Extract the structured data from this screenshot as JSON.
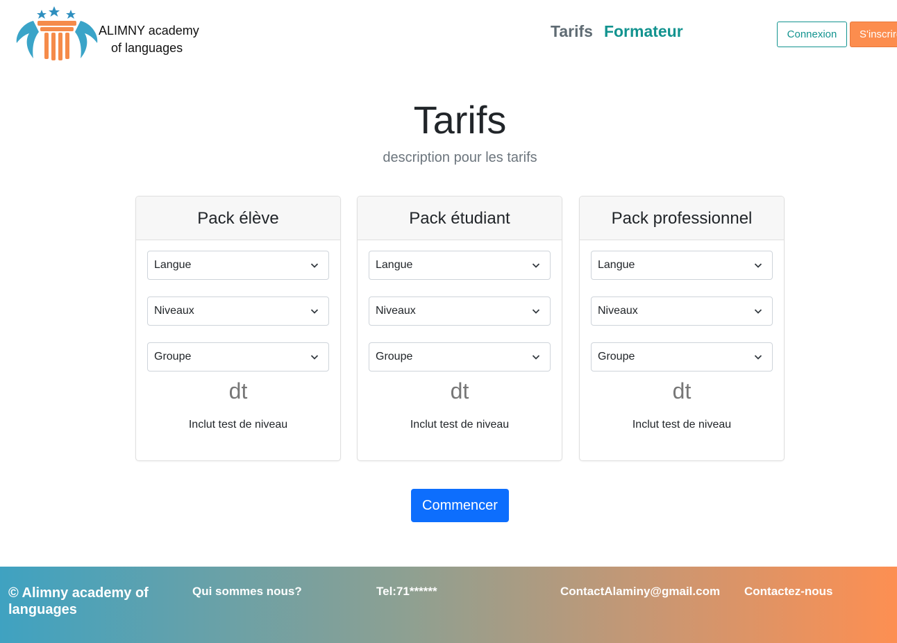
{
  "header": {
    "brand_line1": "ALIMNY academy",
    "brand_line2": "of languages",
    "nav": [
      "Tarifs",
      "Formateur"
    ],
    "login_label": "Connexion",
    "signup_label": "S'inscrire"
  },
  "colors": {
    "teal": "#12938f",
    "orange": "#fc8d4e",
    "primary": "#0d6efd"
  },
  "main": {
    "title": "Tarifs",
    "description": "description pour les tarifs",
    "cta_label": "Commencer",
    "cards": [
      {
        "title": "Pack élève",
        "selects": [
          "Langue",
          "Niveaux",
          "Groupe"
        ],
        "price": "dt",
        "note": "Inclut test de niveau"
      },
      {
        "title": "Pack étudiant",
        "selects": [
          "Langue",
          "Niveaux",
          "Groupe"
        ],
        "price": "dt",
        "note": "Inclut test de niveau"
      },
      {
        "title": "Pack professionnel",
        "selects": [
          "Langue",
          "Niveaux",
          "Groupe"
        ],
        "price": "dt",
        "note": "Inclut test de niveau"
      }
    ]
  },
  "footer": {
    "copyright": "© Alimny academy of languages",
    "about": "Qui sommes nous?",
    "tel": "Tel:71******",
    "email": "ContactAlaminy@gmail.com",
    "contact": "Contactez-nous"
  }
}
